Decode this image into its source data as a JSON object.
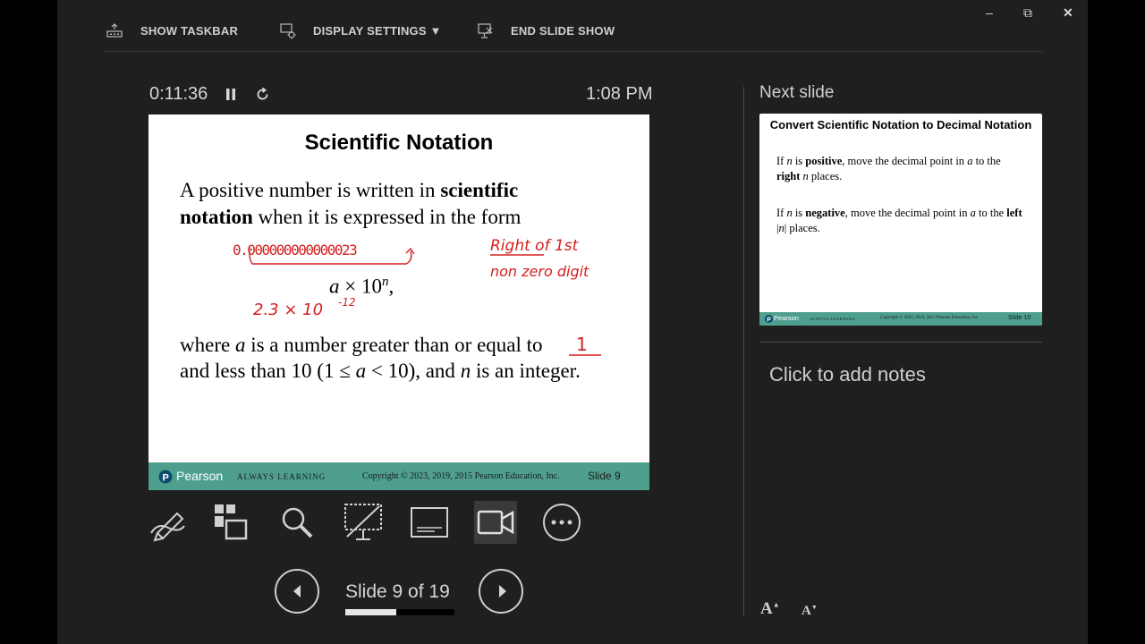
{
  "toolbar": {
    "show_taskbar": "SHOW TASKBAR",
    "display_settings": "DISPLAY SETTINGS ▼",
    "end_slide_show": "END SLIDE SHOW"
  },
  "window_controls": {
    "minimize": "–",
    "restore": "⧉",
    "close": "✕"
  },
  "timer": "0:11:36",
  "clock": "1:08 PM",
  "current_slide": {
    "title": "Scientific Notation",
    "line1_a": "A positive number is written in ",
    "line1_b": "scientific",
    "line2_a": "notation",
    "line2_b": " when it is expressed in the form",
    "formula_a": "a",
    "formula_times": " × 10",
    "formula_n": "n",
    "formula_comma": ",",
    "line3_a": "where ",
    "line3_b": "a",
    "line3_c": " is a number greater than or equal to",
    "line4_a": "and less than 10 (1 ≤ ",
    "line4_b": "a",
    "line4_c": " < 10), and ",
    "line4_d": "n",
    "line4_e": " is an integer.",
    "ink": {
      "zeros": "0.000000000000023",
      "right_of": "Right of 1st",
      "nonzero": "non zero digit",
      "example_base": "2.3 × 10",
      "example_exp": "-12",
      "blank": "1"
    },
    "footer": {
      "brand": "Pearson",
      "tagline": "ALWAYS LEARNING",
      "copyright": "Copyright © 2023, 2019, 2015 Pearson Education, Inc.",
      "slide_num": "Slide 9"
    }
  },
  "slide_counter": "Slide 9 of 19",
  "progress_fraction": 0.47,
  "next_slide_label": "Next slide",
  "next_slide": {
    "title": "Convert Scientific Notation to Decimal Notation",
    "p1_a": "If ",
    "p1_n": "n",
    "p1_b": " is ",
    "p1_pos": "positive",
    "p1_c": ", move the decimal point in ",
    "p1_a2": "a",
    "p1_d": " to the ",
    "p1_right": "right",
    "p1_e": " ",
    "p1_n2": "n",
    "p1_f": " places.",
    "p2_a": "If ",
    "p2_n": "n",
    "p2_b": " is ",
    "p2_neg": "negative",
    "p2_c": ", move the decimal point in ",
    "p2_a2": "a",
    "p2_d": " to the ",
    "p2_left": "left",
    "p2_e": " |",
    "p2_n2": "n",
    "p2_f": "| places.",
    "footer": {
      "brand": "Pearson",
      "tagline": "ALWAYS LEARNING",
      "copyright": "Copyright © 2023, 2019, 2015 Pearson Education, Inc.",
      "slide_num": "Slide 10"
    }
  },
  "notes_placeholder": "Click to add notes",
  "font_controls": {
    "increase": "A",
    "decrease": "A"
  },
  "colors": {
    "ink_red": "#d42020",
    "footer_teal": "#4f9f8e",
    "background": "#1f1f1f"
  }
}
